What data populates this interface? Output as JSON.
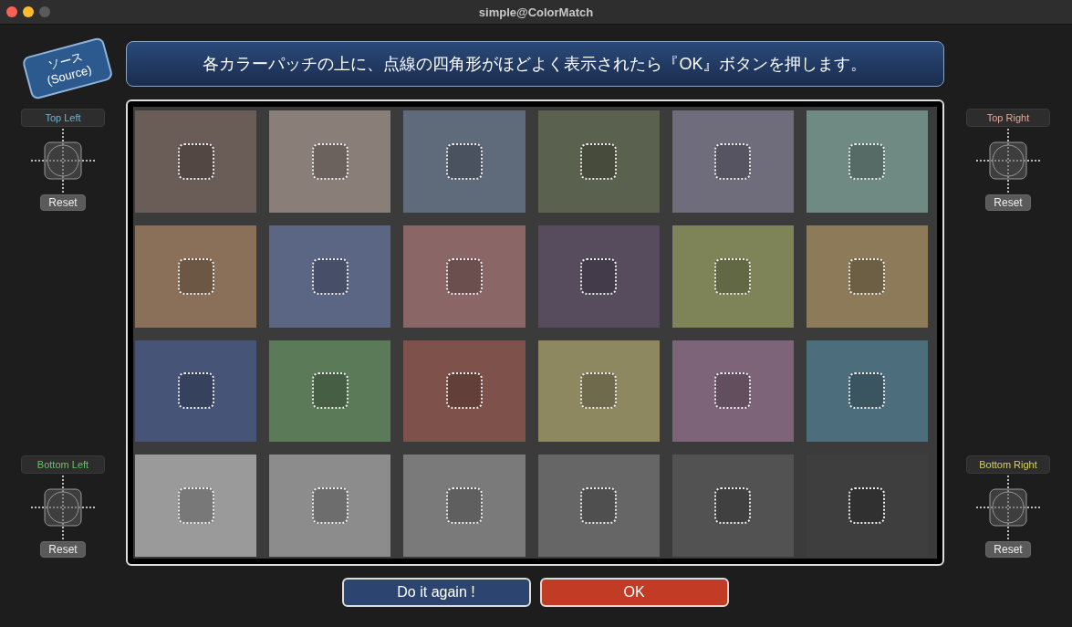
{
  "window": {
    "title": "simple@ColorMatch"
  },
  "source_badge": "ソース\n(Source)",
  "instruction": "各カラーパッチの上に、点線の四角形がほどよく表示されたら『OK』ボタンを押します。",
  "left_panel": {
    "corners": [
      {
        "label": "Top Left",
        "color": "#6ab4d4",
        "reset": "Reset"
      },
      {
        "label": "Bottom Left",
        "color": "#5cc85c",
        "reset": "Reset"
      }
    ]
  },
  "right_panel": {
    "corners": [
      {
        "label": "Top Right",
        "color": "#e4a898",
        "reset": "Reset"
      },
      {
        "label": "Bottom Right",
        "color": "#d4d060",
        "reset": "Reset"
      }
    ]
  },
  "patches": [
    {
      "color": "#6a5c56"
    },
    {
      "color": "#8a7e78"
    },
    {
      "color": "#5f6a7a"
    },
    {
      "color": "#5a614e"
    },
    {
      "color": "#6f6c7c"
    },
    {
      "color": "#6f8a82"
    },
    {
      "color": "#8a7058"
    },
    {
      "color": "#5a6684"
    },
    {
      "color": "#8a6666"
    },
    {
      "color": "#574c5e"
    },
    {
      "color": "#7e8458"
    },
    {
      "color": "#8c7a58"
    },
    {
      "color": "#465478"
    },
    {
      "color": "#5a7a58"
    },
    {
      "color": "#7e524a"
    },
    {
      "color": "#8e8860"
    },
    {
      "color": "#7e6478"
    },
    {
      "color": "#4c6e7c"
    },
    {
      "color": "#9a9a9a"
    },
    {
      "color": "#8c8c8c"
    },
    {
      "color": "#7a7a7a"
    },
    {
      "color": "#666666"
    },
    {
      "color": "#525252"
    },
    {
      "color": "#3e3e3e"
    }
  ],
  "buttons": [
    {
      "label": "Do it again !",
      "kind": "secondary"
    },
    {
      "label": "OK",
      "kind": "primary"
    }
  ]
}
